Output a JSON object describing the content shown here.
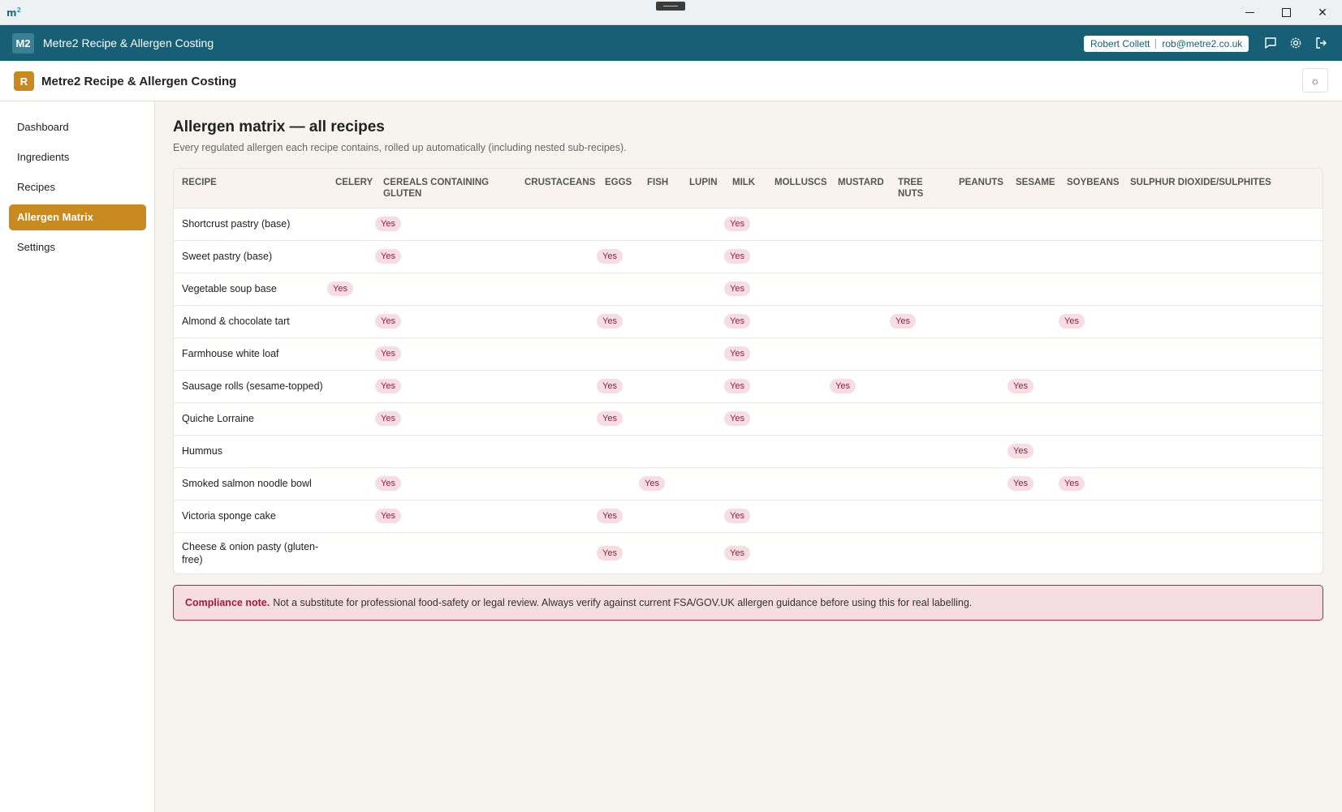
{
  "os": {
    "logo": "m",
    "logo_sup": "2"
  },
  "header": {
    "logo": "M2",
    "title": "Metre2 Recipe & Allergen Costing",
    "user_name": "Robert Collett",
    "user_email": "rob@metre2.co.uk"
  },
  "subheader": {
    "badge": "R",
    "title": "Metre2 Recipe & Allergen Costing"
  },
  "sidebar": {
    "items": [
      {
        "label": "Dashboard"
      },
      {
        "label": "Ingredients"
      },
      {
        "label": "Recipes"
      },
      {
        "label": "Allergen Matrix",
        "active": true
      },
      {
        "label": "Settings"
      }
    ]
  },
  "main": {
    "title": "Allergen matrix — all recipes",
    "subtitle": "Every regulated allergen each recipe contains, rolled up automatically (including nested sub-recipes).",
    "yes_label": "Yes",
    "columns": [
      "RECIPE",
      "CELERY",
      "CEREALS CONTAINING GLUTEN",
      "CRUSTACEANS",
      "EGGS",
      "FISH",
      "LUPIN",
      "MILK",
      "MOLLUSCS",
      "MUSTARD",
      "TREE NUTS",
      "PEANUTS",
      "SESAME",
      "SOYBEANS",
      "SULPHUR DIOXIDE/SULPHITES"
    ],
    "rows": [
      {
        "recipe": "Shortcrust pastry (base)",
        "allergens": [
          "CEREALS CONTAINING GLUTEN",
          "MILK"
        ]
      },
      {
        "recipe": "Sweet pastry (base)",
        "allergens": [
          "CEREALS CONTAINING GLUTEN",
          "EGGS",
          "MILK"
        ]
      },
      {
        "recipe": "Vegetable soup base",
        "allergens": [
          "CELERY",
          "MILK"
        ]
      },
      {
        "recipe": "Almond & chocolate tart",
        "allergens": [
          "CEREALS CONTAINING GLUTEN",
          "EGGS",
          "MILK",
          "TREE NUTS",
          "SOYBEANS"
        ]
      },
      {
        "recipe": "Farmhouse white loaf",
        "allergens": [
          "CEREALS CONTAINING GLUTEN",
          "MILK"
        ]
      },
      {
        "recipe": "Sausage rolls (sesame-topped)",
        "allergens": [
          "CEREALS CONTAINING GLUTEN",
          "EGGS",
          "MILK",
          "MUSTARD",
          "SESAME"
        ]
      },
      {
        "recipe": "Quiche Lorraine",
        "allergens": [
          "CEREALS CONTAINING GLUTEN",
          "EGGS",
          "MILK"
        ]
      },
      {
        "recipe": "Hummus",
        "allergens": [
          "SESAME"
        ]
      },
      {
        "recipe": "Smoked salmon noodle bowl",
        "allergens": [
          "CEREALS CONTAINING GLUTEN",
          "FISH",
          "SESAME",
          "SOYBEANS"
        ]
      },
      {
        "recipe": "Victoria sponge cake",
        "allergens": [
          "CEREALS CONTAINING GLUTEN",
          "EGGS",
          "MILK"
        ]
      },
      {
        "recipe": "Cheese & onion pasty (gluten-free)",
        "allergens": [
          "EGGS",
          "MILK"
        ]
      }
    ]
  },
  "note": {
    "label": "Compliance note.",
    "text": "Not a substitute for professional food-safety or legal review. Always verify against current FSA/GOV.UK allergen guidance before using this for real labelling."
  },
  "colors": {
    "header": "#165f74",
    "accent": "#c88a1f",
    "pill_bg": "#f6dde3",
    "pill_text": "#8a2040",
    "note_border": "#b02448"
  },
  "icons": [
    "chat-icon",
    "gear-icon",
    "logout-icon",
    "theme-sun-icon",
    "minimize-icon",
    "maximize-icon",
    "close-icon"
  ]
}
